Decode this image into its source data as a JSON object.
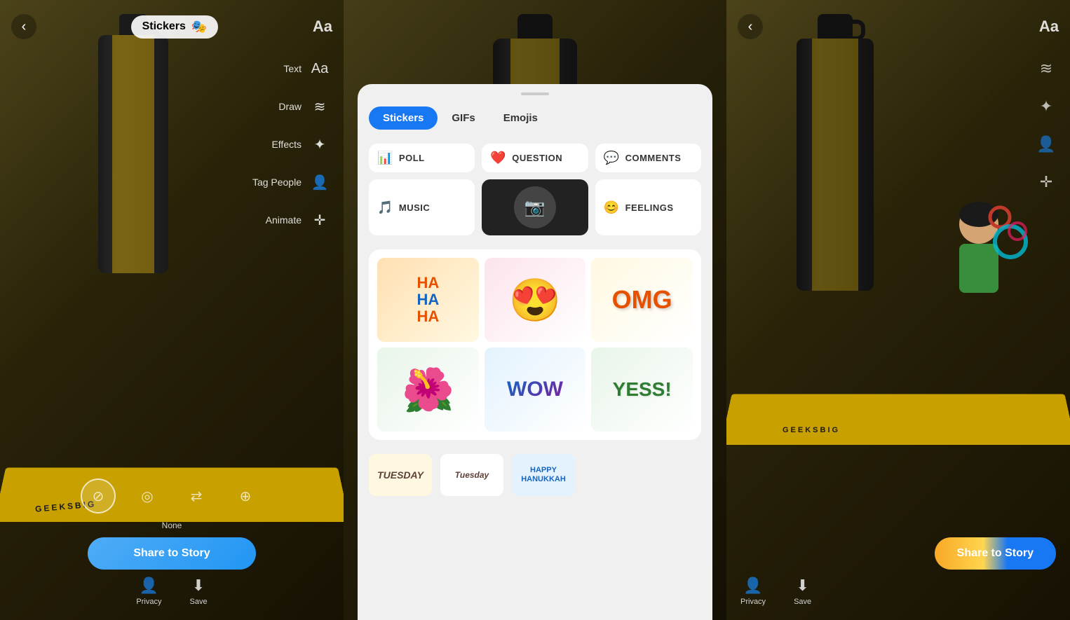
{
  "panels": {
    "left": {
      "back_label": "‹",
      "stickers_label": "Stickers",
      "tools": [
        {
          "label": "Text",
          "icon": "Aa"
        },
        {
          "label": "Draw",
          "icon": "✏"
        },
        {
          "label": "Effects",
          "icon": "✨"
        },
        {
          "label": "Tag People",
          "icon": "👤"
        },
        {
          "label": "Animate",
          "icon": "⊕"
        }
      ],
      "filter_options": [
        {
          "label": "None",
          "icon": "⊘",
          "active": true
        },
        {
          "label": "",
          "icon": "◎",
          "active": false
        },
        {
          "label": "",
          "icon": "⇄",
          "active": false
        },
        {
          "label": "",
          "icon": "⊕",
          "active": false
        }
      ],
      "share_label": "Share to Story",
      "bottom_actions": [
        {
          "label": "Privacy",
          "icon": "👤"
        },
        {
          "label": "Save",
          "icon": "↓"
        }
      ]
    },
    "center": {
      "sheet": {
        "tabs": [
          {
            "label": "Stickers",
            "active": true
          },
          {
            "label": "GIFs",
            "active": false
          },
          {
            "label": "Emojis",
            "active": false
          }
        ],
        "options": [
          {
            "label": "POLL",
            "icon": "📊"
          },
          {
            "label": "QUESTION",
            "icon": "❤️"
          },
          {
            "label": "COMMENTS",
            "icon": "💬"
          },
          {
            "label": "MUSIC",
            "icon": "🎵"
          },
          {
            "label": "SELFIE",
            "icon": "📷"
          },
          {
            "label": "FEELINGS",
            "icon": "😊"
          }
        ],
        "stickers": [
          {
            "type": "haha",
            "alt": "Ha Ha Ha sticker"
          },
          {
            "type": "love",
            "alt": "Heart eyes bitmoji"
          },
          {
            "type": "omg",
            "alt": "OMG sticker"
          },
          {
            "type": "flower",
            "alt": "Flower crown bitmoji"
          },
          {
            "type": "wow",
            "alt": "Wow sticker"
          },
          {
            "type": "yess",
            "alt": "Yess sticker"
          }
        ],
        "strip": [
          {
            "label": "TUESDAY",
            "style": "tuesday"
          },
          {
            "label": "Tuesday",
            "style": "cursive"
          },
          {
            "label": "HAPPY HANUKKAH",
            "style": "hanukkah"
          }
        ]
      }
    },
    "right": {
      "back_label": "‹",
      "aa_label": "Aa",
      "tools": [
        {
          "icon": "✏"
        },
        {
          "icon": "✨"
        },
        {
          "icon": "👤"
        },
        {
          "icon": "⊕"
        }
      ],
      "share_label": "Share to Story",
      "bottom_actions": [
        {
          "label": "Privacy",
          "icon": "👤"
        },
        {
          "label": "Save",
          "icon": "↓"
        }
      ]
    }
  },
  "colors": {
    "accent_blue": "#1877f2",
    "share_blue": "#1877f2",
    "tab_active_bg": "#1877f2",
    "tab_active_text": "#ffffff",
    "background_dark": "#2a2008",
    "bottle_stripe": "#c8a000"
  }
}
